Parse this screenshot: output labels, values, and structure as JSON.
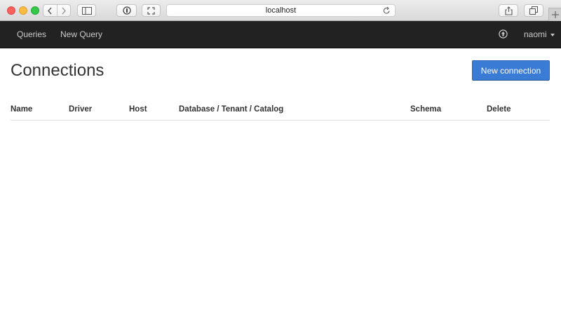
{
  "browser": {
    "address": "localhost"
  },
  "navbar": {
    "links": [
      "Queries",
      "New Query"
    ],
    "user": "naomi"
  },
  "page": {
    "title": "Connections",
    "new_connection_label": "New connection"
  },
  "table": {
    "columns": [
      "Name",
      "Driver",
      "Host",
      "Database / Tenant / Catalog",
      "Schema",
      "Delete"
    ],
    "rows": []
  },
  "colors": {
    "navbar_bg": "#222222",
    "primary_button": "#3a7bd5"
  }
}
